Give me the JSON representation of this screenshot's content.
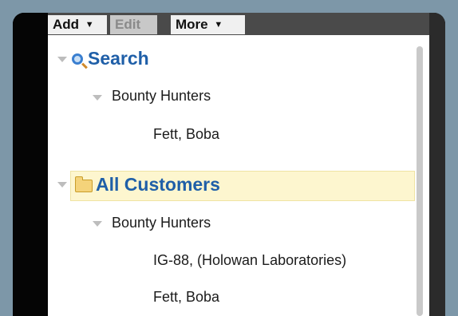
{
  "toolbar": {
    "add_label": "Add",
    "edit_label": "Edit",
    "more_label": "More"
  },
  "tree": {
    "search": {
      "label": "Search",
      "group": {
        "label": "Bounty Hunters",
        "items": [
          "Fett, Boba"
        ]
      }
    },
    "all_customers": {
      "label": "All Customers",
      "group": {
        "label": "Bounty Hunters",
        "items": [
          "IG-88, (Holowan Laboratories)",
          "Fett, Boba"
        ]
      }
    }
  },
  "colors": {
    "node_label": "#1f5fa8",
    "selected_row_bg": "#fdf6cf"
  },
  "icons": {
    "search": "search-icon",
    "folder": "folder-icon",
    "expand": "triangle-down-icon",
    "caret": "chevron-down-icon"
  }
}
